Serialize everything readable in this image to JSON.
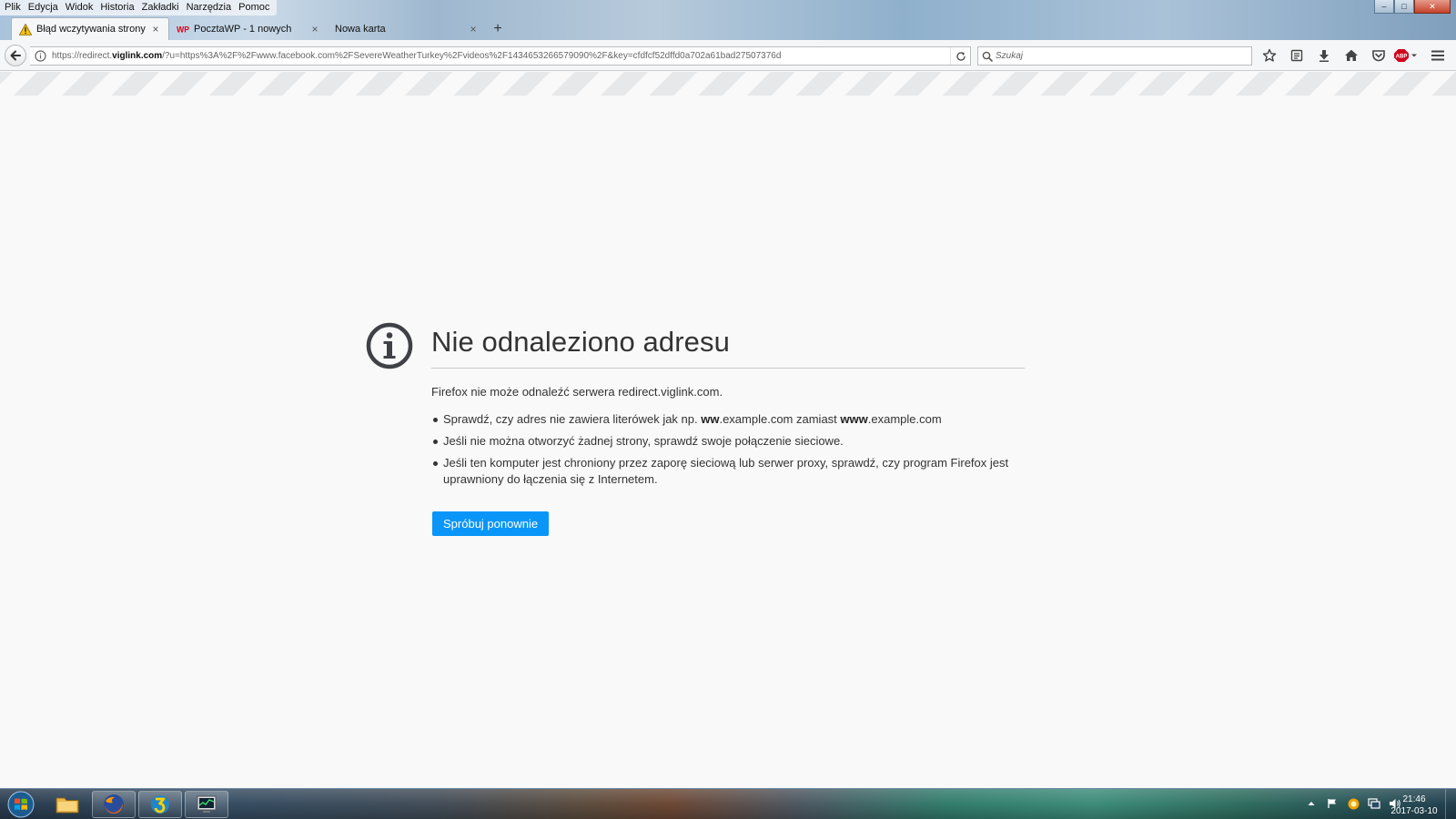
{
  "menubar": {
    "items": [
      "Plik",
      "Edycja",
      "Widok",
      "Historia",
      "Zakładki",
      "Narzędzia",
      "Pomoc"
    ]
  },
  "window_controls": {
    "minimize": "–",
    "maximize": "□",
    "close": "✕"
  },
  "tabs": [
    {
      "title": "Błąd wczytywania strony",
      "icon": "warning-icon",
      "close": "×",
      "active": true
    },
    {
      "title": "PocztaWP - 1 nowych",
      "icon": "wp-icon",
      "close": "×",
      "active": false
    },
    {
      "title": "Nowa karta",
      "icon": "",
      "close": "×",
      "active": false
    }
  ],
  "new_tab_label": "+",
  "navbar": {
    "url_prefix": "https://redirect.",
    "url_domain": "viglink.com",
    "url_rest": "/?u=https%3A%2F%2Fwww.facebook.com%2FSevereWeatherTurkey%2Fvideos%2F1434653266579090%2F&key=cfdfcf52dffd0a702a61bad27507376d",
    "search_placeholder": "Szukaj",
    "icons": [
      "bookmark-star-icon",
      "reading-list-icon",
      "download-icon",
      "home-icon",
      "pocket-icon",
      "adblock-icon"
    ],
    "adblock_label": "ABP"
  },
  "error_page": {
    "title": "Nie odnaleziono adresu",
    "description": "Firefox nie może odnaleźć serwera redirect.viglink.com.",
    "hint1": {
      "before": "Sprawdź, czy adres nie zawiera literówek jak np. ",
      "bold1": "ww",
      "middle": ".example.com zamiast ",
      "bold2": "www",
      "after": ".example.com"
    },
    "hint2": "Jeśli nie można otworzyć żadnej strony, sprawdź swoje połączenie sieciowe.",
    "hint3": "Jeśli ten komputer jest chroniony przez zaporę sieciową lub serwer proxy, sprawdź, czy program Firefox jest uprawniony do łączenia się z Internetem.",
    "retry_button": "Spróbuj ponownie",
    "accent_color": "#0996f8"
  },
  "taskbar": {
    "apps": [
      "windows-explorer-icon",
      "firefox-icon",
      "app-3-icon",
      "task-manager-icon"
    ],
    "tray_icons": [
      "tray-expand-icon",
      "action-center-flag-icon",
      "update-icon",
      "network-icon",
      "volume-icon"
    ],
    "time": "21:46",
    "date": "2017-03-10"
  }
}
